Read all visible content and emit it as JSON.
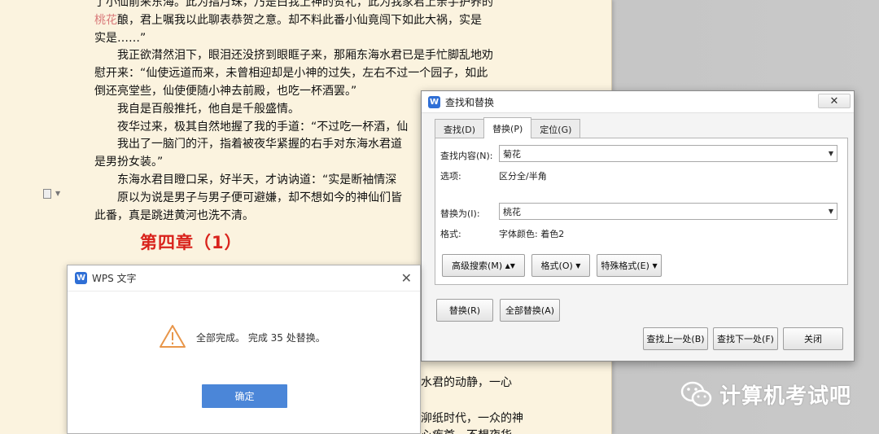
{
  "document": {
    "lines": [
      {
        "text": "了小仙前来东海。此为指月珠，乃是白我上神的贺礼，此为我家君上亲手护养的",
        "indent": false
      },
      {
        "pre": "",
        "hl": "桃花",
        "text": "酿，君上嘱我以此聊表恭贺之意。却不料此番小仙竟闯下如此大祸，实是",
        "indent": false
      },
      {
        "text": "实是……”",
        "indent": false
      },
      {
        "text": "我正欲潸然泪下，眼泪还没挤到眼眶子来，那厢东海水君已是手忙脚乱地劝",
        "indent": true
      },
      {
        "text": "慰开来：“仙使远道而来，未曾相迎却是小神的过失，左右不过一个园子，如此",
        "indent": false
      },
      {
        "text": "倒还亮堂些，仙使便随小神去前殿，也吃一杯酒罢。”",
        "indent": false
      },
      {
        "text": "我自是百般推托，他自是千般盛情。",
        "indent": true
      },
      {
        "text": "夜华过来，极其自然地握了我的手道：“不过吃一杯酒，仙",
        "indent": true
      },
      {
        "text": "我出了一脑门的汗，指着被夜华紧握的右手对东海水君道",
        "indent": true
      },
      {
        "text": "是男扮女装。”",
        "indent": false
      },
      {
        "text": "东海水君目瞪口呆，好半天，才讷讷道：“实是断袖情深",
        "indent": true
      },
      {
        "text": "原以为说是男子与男子便可避嫌，却不想如今的神仙们皆",
        "indent": true
      },
      {
        "text": "此番，真是跳进黄河也洗不清。",
        "indent": false
      }
    ],
    "chapter_heading": "第四章（1）",
    "lower_lines": [
      "水君的动静，一心",
      "",
      "泖纸时代，一众的神",
      "心疾首，不想夜华"
    ]
  },
  "watermark": {
    "text": "计算机考试吧",
    "logo": "wechat-logo"
  },
  "find_replace": {
    "title": "查找和替换",
    "close_symbol": "✕",
    "tabs": [
      {
        "label": "查找(D)",
        "active": false
      },
      {
        "label": "替换(P)",
        "active": true
      },
      {
        "label": "定位(G)",
        "active": false
      }
    ],
    "find_label": "查找内容(N):",
    "find_value": "菊花",
    "options_label": "选项:",
    "options_value": "区分全/半角",
    "replace_label": "替换为(I):",
    "replace_value": "桃花",
    "format_label": "格式:",
    "format_value": "字体颜色: 着色2",
    "advanced_search": "高级搜索(M)",
    "format_button": "格式(O)",
    "special_format": "特殊格式(E)",
    "replace_button": "替换(R)",
    "replace_all_button": "全部替换(A)",
    "find_prev": "查找上一处(B)",
    "find_next": "查找下一处(F)",
    "close_button": "关闭"
  },
  "message_box": {
    "title": "WPS 文字",
    "close_symbol": "✕",
    "message": "全部完成。 完成 35 处替换。",
    "ok": "确定"
  }
}
